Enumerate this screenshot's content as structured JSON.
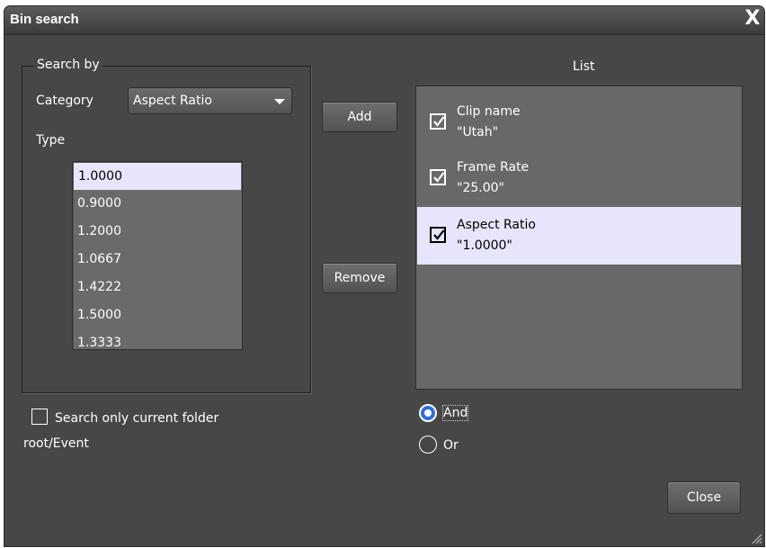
{
  "window": {
    "title": "Bin search",
    "close_glyph": "X"
  },
  "search_by": {
    "legend": "Search by",
    "category_label": "Category",
    "category_value": "Aspect Ratio",
    "type_label": "Type",
    "type_items": [
      "1.0000",
      "0.9000",
      "1.2000",
      "1.0667",
      "1.4222",
      "1.5000",
      "1.3333"
    ],
    "selected_type_index": 0
  },
  "buttons": {
    "add": "Add",
    "remove": "Remove",
    "close": "Close"
  },
  "list": {
    "header": "List",
    "entries": [
      {
        "name": "Clip name",
        "value": "\"Utah\"",
        "checked": true
      },
      {
        "name": "Frame Rate",
        "value": "\"25.00\"",
        "checked": true
      },
      {
        "name": "Aspect Ratio",
        "value": "\"1.0000\"",
        "checked": true
      }
    ],
    "selected_index": 2
  },
  "options": {
    "search_current_folder": "Search only current folder",
    "folder_path": "root/Event",
    "search_current_folder_checked": false,
    "logic": {
      "and_label": "And",
      "or_label": "Or",
      "selected": "And"
    }
  },
  "icons": [
    "close-icon",
    "dropdown-arrow-icon",
    "checkmark-icon",
    "resize-grip-icon"
  ],
  "colors": {
    "background": "#474747",
    "selection": "#e7e5fb",
    "radio_accent": "#2e6fdc"
  }
}
